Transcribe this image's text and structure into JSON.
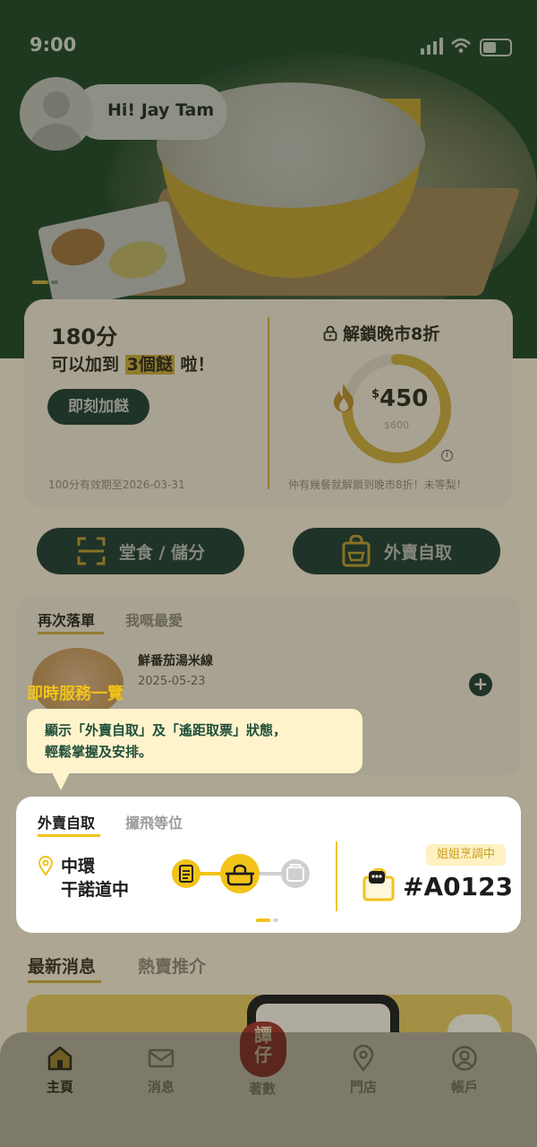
{
  "status_bar": {
    "time": "9:00"
  },
  "header": {
    "greeting": "Hi! Jay Tam"
  },
  "points_card": {
    "score": "180分",
    "line_prefix": "可以加到",
    "line_highlight": "3個餸",
    "line_suffix": "啦！",
    "add_button": "即刻加餸",
    "expiry": "100分有效期至2026-03-31",
    "unlock_title": "解鎖晚市8折",
    "currency": "$",
    "current_spend": "450",
    "target_spend": "$600",
    "progress_fraction": 0.75,
    "unlock_note": "仲有幾餐就解鎖到晚市8折！未等梨！"
  },
  "actions": {
    "dine_in": "堂食 / 儲分",
    "takeaway": "外賣自取"
  },
  "reorder": {
    "tabs": [
      "再次落單",
      "我嘅最愛"
    ],
    "item_name": "鮮番茄湯米線",
    "item_date": "2025-05-23"
  },
  "tooltip": {
    "title": "即時服務一覽",
    "line1": "顯示「外賣自取」及「遙距取票」狀態，",
    "line2": "輕鬆掌握及安排。"
  },
  "live_service": {
    "tabs": [
      "外賣自取",
      "攞飛等位"
    ],
    "shop_line1": "中環",
    "shop_line2": "干諾道中",
    "status_badge": "姐姐烹調中",
    "order_number": "#A0123",
    "current_step": 2,
    "total_steps": 3
  },
  "news": {
    "tabs": [
      "最新消息",
      "熱賣推介"
    ]
  },
  "bottom_nav": {
    "home": "主頁",
    "messages": "消息",
    "points": "著數",
    "stores": "門店",
    "account": "帳戶",
    "logo_text": "譚仔"
  },
  "colors": {
    "brand_green": "#1f3d33",
    "brand_yellow": "#f2c319",
    "accent_red": "#a3332c"
  }
}
